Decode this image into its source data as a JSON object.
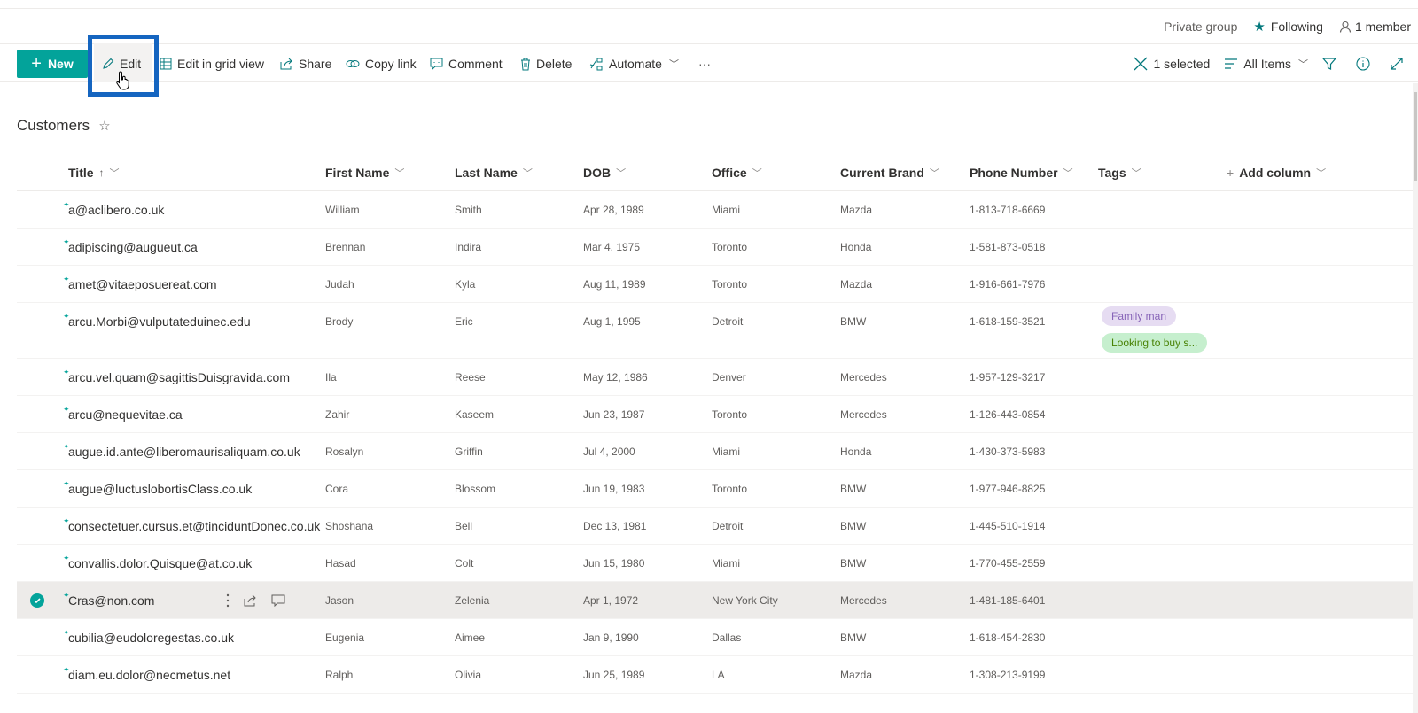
{
  "group_bar": {
    "privacy": "Private group",
    "following": "Following",
    "members": "1 member"
  },
  "commands": {
    "new": "New",
    "edit": "Edit",
    "edit_grid": "Edit in grid view",
    "share": "Share",
    "copy_link": "Copy link",
    "comment": "Comment",
    "delete": "Delete",
    "automate": "Automate",
    "more": "···",
    "selected": "1 selected",
    "view": "All Items"
  },
  "list": {
    "title": "Customers",
    "columns": {
      "title": "Title",
      "first_name": "First Name",
      "last_name": "Last Name",
      "dob": "DOB",
      "office": "Office",
      "brand": "Current Brand",
      "phone": "Phone Number",
      "tags": "Tags",
      "add_column": "Add column"
    },
    "rows": [
      {
        "title": "a@aclibero.co.uk",
        "first": "William",
        "last": "Smith",
        "dob": "Apr 28, 1989",
        "office": "Miami",
        "brand": "Mazda",
        "phone": "1-813-718-6669"
      },
      {
        "title": "adipiscing@augueut.ca",
        "first": "Brennan",
        "last": "Indira",
        "dob": "Mar 4, 1975",
        "office": "Toronto",
        "brand": "Honda",
        "phone": "1-581-873-0518"
      },
      {
        "title": "amet@vitaeposuereat.com",
        "first": "Judah",
        "last": "Kyla",
        "dob": "Aug 11, 1989",
        "office": "Toronto",
        "brand": "Mazda",
        "phone": "1-916-661-7976"
      },
      {
        "title": "arcu.Morbi@vulputateduinec.edu",
        "first": "Brody",
        "last": "Eric",
        "dob": "Aug 1, 1995",
        "office": "Detroit",
        "brand": "BMW",
        "phone": "1-618-159-3521",
        "tags": [
          "Family man",
          "Looking to buy s..."
        ]
      },
      {
        "title": "arcu.vel.quam@sagittisDuisgravida.com",
        "first": "Ila",
        "last": "Reese",
        "dob": "May 12, 1986",
        "office": "Denver",
        "brand": "Mercedes",
        "phone": "1-957-129-3217"
      },
      {
        "title": "arcu@nequevitae.ca",
        "first": "Zahir",
        "last": "Kaseem",
        "dob": "Jun 23, 1987",
        "office": "Toronto",
        "brand": "Mercedes",
        "phone": "1-126-443-0854"
      },
      {
        "title": "augue.id.ante@liberomaurisaliquam.co.uk",
        "first": "Rosalyn",
        "last": "Griffin",
        "dob": "Jul 4, 2000",
        "office": "Miami",
        "brand": "Honda",
        "phone": "1-430-373-5983"
      },
      {
        "title": "augue@luctuslobortisClass.co.uk",
        "first": "Cora",
        "last": "Blossom",
        "dob": "Jun 19, 1983",
        "office": "Toronto",
        "brand": "BMW",
        "phone": "1-977-946-8825"
      },
      {
        "title": "consectetuer.cursus.et@tinciduntDonec.co.uk",
        "first": "Shoshana",
        "last": "Bell",
        "dob": "Dec 13, 1981",
        "office": "Detroit",
        "brand": "BMW",
        "phone": "1-445-510-1914"
      },
      {
        "title": "convallis.dolor.Quisque@at.co.uk",
        "first": "Hasad",
        "last": "Colt",
        "dob": "Jun 15, 1980",
        "office": "Miami",
        "brand": "BMW",
        "phone": "1-770-455-2559"
      },
      {
        "title": "Cras@non.com",
        "first": "Jason",
        "last": "Zelenia",
        "dob": "Apr 1, 1972",
        "office": "New York City",
        "brand": "Mercedes",
        "phone": "1-481-185-6401",
        "selected": true
      },
      {
        "title": "cubilia@eudoloregestas.co.uk",
        "first": "Eugenia",
        "last": "Aimee",
        "dob": "Jan 9, 1990",
        "office": "Dallas",
        "brand": "BMW",
        "phone": "1-618-454-2830"
      },
      {
        "title": "diam.eu.dolor@necmetus.net",
        "first": "Ralph",
        "last": "Olivia",
        "dob": "Jun 25, 1989",
        "office": "LA",
        "brand": "Mazda",
        "phone": "1-308-213-9199"
      }
    ]
  },
  "colors": {
    "accent": "#03a39a",
    "icon": "#03787c",
    "highlight_box": "#1565c0",
    "selected_row": "#edebe9",
    "tag_purple_bg": "#e6dcf2",
    "tag_green_bg": "#c6efce"
  }
}
